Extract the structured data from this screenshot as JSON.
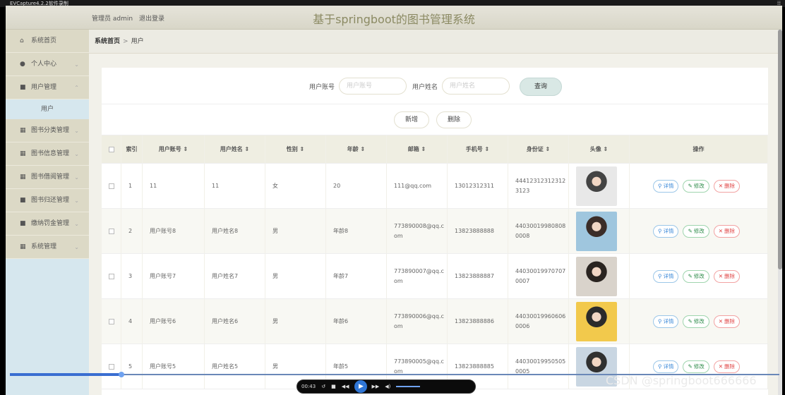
{
  "capture": {
    "title": "EVCapture4.2.2软件录制"
  },
  "header": {
    "user_label": "管理员 admin",
    "logout": "退出登录",
    "title": "基于springboot的图书管理系统"
  },
  "sidebar": {
    "items": [
      {
        "label": "系统首页",
        "icon": "home-icon",
        "glyph": "⌂"
      },
      {
        "label": "个人中心",
        "icon": "user-icon",
        "glyph": "●"
      },
      {
        "label": "用户管理",
        "icon": "user-manage-icon",
        "glyph": "■"
      },
      {
        "label": "图书分类管理",
        "icon": "grid-icon",
        "glyph": "▦"
      },
      {
        "label": "图书信息管理",
        "icon": "grid-icon",
        "glyph": "▦"
      },
      {
        "label": "图书借阅管理",
        "icon": "grid-icon",
        "glyph": "▦"
      },
      {
        "label": "图书归还管理",
        "icon": "book-icon",
        "glyph": "■"
      },
      {
        "label": "缴纳罚金管理",
        "icon": "money-icon",
        "glyph": "■"
      },
      {
        "label": "系统管理",
        "icon": "settings-grid-icon",
        "glyph": "▦"
      }
    ],
    "sub_item": "用户"
  },
  "breadcrumb": {
    "home": "系统首页",
    "separator": ">",
    "current": "用户"
  },
  "search": {
    "account_label": "用户账号",
    "account_placeholder": "用户账号",
    "name_label": "用户姓名",
    "name_placeholder": "用户姓名",
    "query": "查询"
  },
  "actions": {
    "add": "新增",
    "delete": "删除"
  },
  "table": {
    "headers": [
      "索引",
      "用户账号 ⇕",
      "用户姓名 ⇕",
      "性别 ⇕",
      "年龄 ⇕",
      "邮箱 ⇕",
      "手机号 ⇕",
      "身份证 ⇕",
      "头像 ⇕",
      "操作"
    ],
    "rows": [
      {
        "idx": "1",
        "account": "11",
        "name": "11",
        "gender": "女",
        "age": "20",
        "email": "111@qq.com",
        "phone": "13012312311",
        "id": "444123123123123123"
      },
      {
        "idx": "2",
        "account": "用户账号8",
        "name": "用户姓名8",
        "gender": "男",
        "age": "年龄8",
        "email": "773890008@qq.com",
        "phone": "13823888888",
        "id": "440300199808080008"
      },
      {
        "idx": "3",
        "account": "用户账号7",
        "name": "用户姓名7",
        "gender": "男",
        "age": "年龄7",
        "email": "773890007@qq.com",
        "phone": "13823888887",
        "id": "440300199707070007"
      },
      {
        "idx": "4",
        "account": "用户账号6",
        "name": "用户姓名6",
        "gender": "男",
        "age": "年龄6",
        "email": "773890006@qq.com",
        "phone": "13823888886",
        "id": "440300199606060006"
      },
      {
        "idx": "5",
        "account": "用户账号5",
        "name": "用户姓名5",
        "gender": "男",
        "age": "年龄5",
        "email": "773890005@qq.com",
        "phone": "13823888885",
        "id": "440300199505050005"
      }
    ],
    "op": {
      "detail": "详情",
      "edit": "修改",
      "delete": "删除"
    }
  },
  "player": {
    "time": "00:43",
    "progress": 0.14
  },
  "watermark": "CSDN @springboot666666",
  "colors": {
    "header": "#dcd9c6",
    "sidebar": "#d6e7ee",
    "title": "#8b8a63",
    "detail": "#3d8ad8",
    "edit": "#2e8c4a",
    "delete": "#e04646"
  }
}
